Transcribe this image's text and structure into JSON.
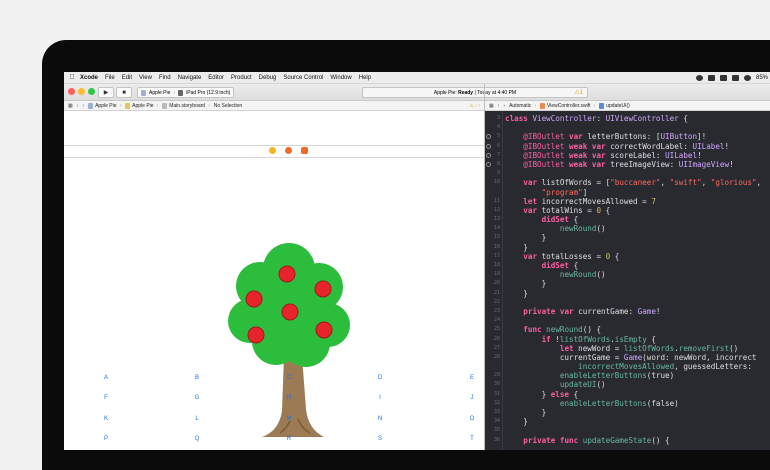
{
  "menu_bar": {
    "items": [
      "Xcode",
      "File",
      "Edit",
      "View",
      "Find",
      "Navigate",
      "Editor",
      "Product",
      "Debug",
      "Source Control",
      "Window",
      "Help"
    ],
    "battery": "85%"
  },
  "toolbar": {
    "scheme_app": "Apple Pie",
    "scheme_device": "iPad Pro (12.9 inch)",
    "activity_app": "Apple Pie:",
    "activity_status": "Ready",
    "activity_time": "Today at 4:40 PM",
    "warning_count": "1"
  },
  "left_jump_bar": {
    "crumbs": [
      "Apple Pie",
      "Apple Pie",
      "Main.storyboard",
      "No Selection"
    ]
  },
  "right_jump_bar": {
    "crumbs": [
      "Automatic",
      "ViewController.swift",
      "updateUI()"
    ]
  },
  "letter_buttons": [
    [
      "A",
      "B",
      "C",
      "D",
      "E"
    ],
    [
      "F",
      "G",
      "H",
      "I",
      "J"
    ],
    [
      "K",
      "L",
      "M",
      "N",
      "O"
    ],
    [
      "P",
      "Q",
      "R",
      "S",
      "T"
    ]
  ],
  "code_lines": [
    {
      "num": "3",
      "text": "class ViewController: UIViewController {",
      "outlet": false
    },
    {
      "num": "4",
      "text": "",
      "outlet": false
    },
    {
      "num": "5",
      "text": "    @IBOutlet var letterButtons: [UIButton]!",
      "outlet": true
    },
    {
      "num": "6",
      "text": "    @IBOutlet weak var correctWordLabel: UILabel!",
      "outlet": true
    },
    {
      "num": "7",
      "text": "    @IBOutlet weak var scoreLabel: UILabel!",
      "outlet": true
    },
    {
      "num": "8",
      "text": "    @IBOutlet weak var treeImageView: UIImageView!",
      "outlet": true
    },
    {
      "num": "9",
      "text": "",
      "outlet": false
    },
    {
      "num": "10",
      "text": "    var listOfWords = [\"buccaneer\", \"swift\", \"glorious\",",
      "outlet": false
    },
    {
      "num": "",
      "text": "        \"program\"]",
      "outlet": false
    },
    {
      "num": "11",
      "text": "    let incorrectMovesAllowed = 7",
      "outlet": false
    },
    {
      "num": "12",
      "text": "    var totalWins = 0 {",
      "outlet": false
    },
    {
      "num": "13",
      "text": "        didSet {",
      "outlet": false
    },
    {
      "num": "14",
      "text": "            newRound()",
      "outlet": false
    },
    {
      "num": "15",
      "text": "        }",
      "outlet": false
    },
    {
      "num": "16",
      "text": "    }",
      "outlet": false
    },
    {
      "num": "17",
      "text": "    var totalLosses = 0 {",
      "outlet": false
    },
    {
      "num": "18",
      "text": "        didSet {",
      "outlet": false
    },
    {
      "num": "19",
      "text": "            newRound()",
      "outlet": false
    },
    {
      "num": "20",
      "text": "        }",
      "outlet": false
    },
    {
      "num": "21",
      "text": "    }",
      "outlet": false
    },
    {
      "num": "22",
      "text": "",
      "outlet": false
    },
    {
      "num": "23",
      "text": "    private var currentGame: Game!",
      "outlet": false
    },
    {
      "num": "24",
      "text": "",
      "outlet": false
    },
    {
      "num": "25",
      "text": "    func newRound() {",
      "outlet": false
    },
    {
      "num": "26",
      "text": "        if !listOfWords.isEmpty {",
      "outlet": false
    },
    {
      "num": "27",
      "text": "            let newWord = listOfWords.removeFirst()",
      "outlet": false
    },
    {
      "num": "28",
      "text": "            currentGame = Game(word: newWord, incorrect",
      "outlet": false
    },
    {
      "num": "",
      "text": "                incorrectMovesAllowed, guessedLetters: ",
      "outlet": false
    },
    {
      "num": "29",
      "text": "            enableLetterButtons(true)",
      "outlet": false
    },
    {
      "num": "30",
      "text": "            updateUI()",
      "outlet": false
    },
    {
      "num": "31",
      "text": "        } else {",
      "outlet": false
    },
    {
      "num": "32",
      "text": "            enableLetterButtons(false)",
      "outlet": false
    },
    {
      "num": "33",
      "text": "        }",
      "outlet": false
    },
    {
      "num": "34",
      "text": "    }",
      "outlet": false
    },
    {
      "num": "35",
      "text": "",
      "outlet": false
    },
    {
      "num": "36",
      "text": "    private func updateGameState() {",
      "outlet": false
    }
  ],
  "colors": {
    "keyword": "#fc5fa3",
    "type": "#d0a8ff",
    "string": "#fc6a5d",
    "number": "#d0bf69",
    "call": "#67b7a4",
    "plain": "#dfdfe0",
    "letter_button": "#1a74e6"
  }
}
